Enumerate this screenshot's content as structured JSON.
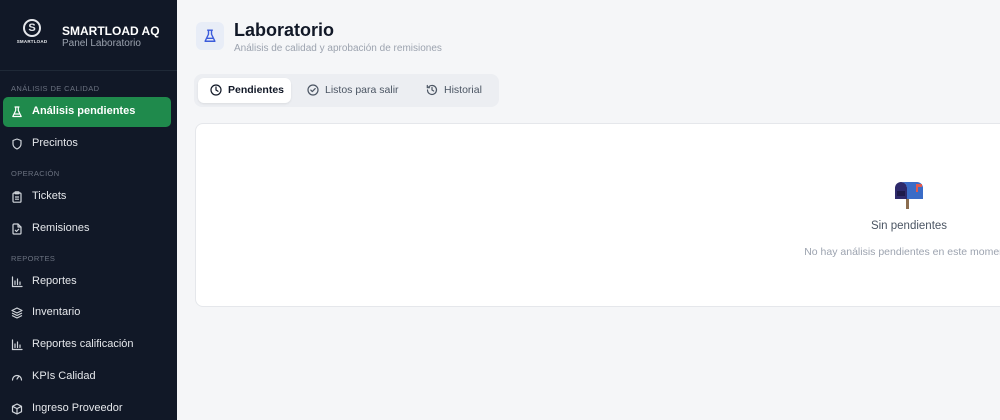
{
  "brand": {
    "logo_text": "SMARTLOAD",
    "logo_letter": "S",
    "name": "SMARTLOAD AQ",
    "subtitle": "Panel Laboratorio"
  },
  "sidebar": {
    "sections": [
      {
        "label": "ANÁLISIS DE CALIDAD",
        "items": [
          {
            "label": "Análisis pendientes",
            "icon": "flask-icon",
            "active": true
          },
          {
            "label": "Precintos",
            "icon": "shield-icon",
            "active": false
          }
        ]
      },
      {
        "label": "OPERACIÓN",
        "items": [
          {
            "label": "Tickets",
            "icon": "clipboard-icon",
            "active": false
          },
          {
            "label": "Remisiones",
            "icon": "file-check-icon",
            "active": false
          }
        ]
      },
      {
        "label": "REPORTES",
        "items": [
          {
            "label": "Reportes",
            "icon": "bar-chart-icon",
            "active": false
          },
          {
            "label": "Inventario",
            "icon": "layers-icon",
            "active": false
          },
          {
            "label": "Reportes calificación",
            "icon": "bar-chart-icon",
            "active": false
          },
          {
            "label": "KPIs Calidad",
            "icon": "gauge-icon",
            "active": false
          },
          {
            "label": "Ingreso Proveedor",
            "icon": "box-icon",
            "active": false
          }
        ]
      }
    ]
  },
  "header": {
    "title": "Laboratorio",
    "subtitle": "Análisis de calidad y aprobación de remisiones",
    "icon": "flask-icon"
  },
  "tabs": [
    {
      "label": "Pendientes",
      "icon": "clock-icon",
      "active": true
    },
    {
      "label": "Listos para salir",
      "icon": "check-circle-icon",
      "active": false
    },
    {
      "label": "Historial",
      "icon": "history-icon",
      "active": false
    }
  ],
  "empty_state": {
    "icon": "mailbox-icon",
    "title": "Sin pendientes",
    "message": "No hay análisis pendientes en este momento"
  },
  "colors": {
    "sidebar_bg": "#111827",
    "active_green": "#1f8a4c",
    "page_bg": "#f5f6f8",
    "accent_blue": "#3b5bdb"
  }
}
